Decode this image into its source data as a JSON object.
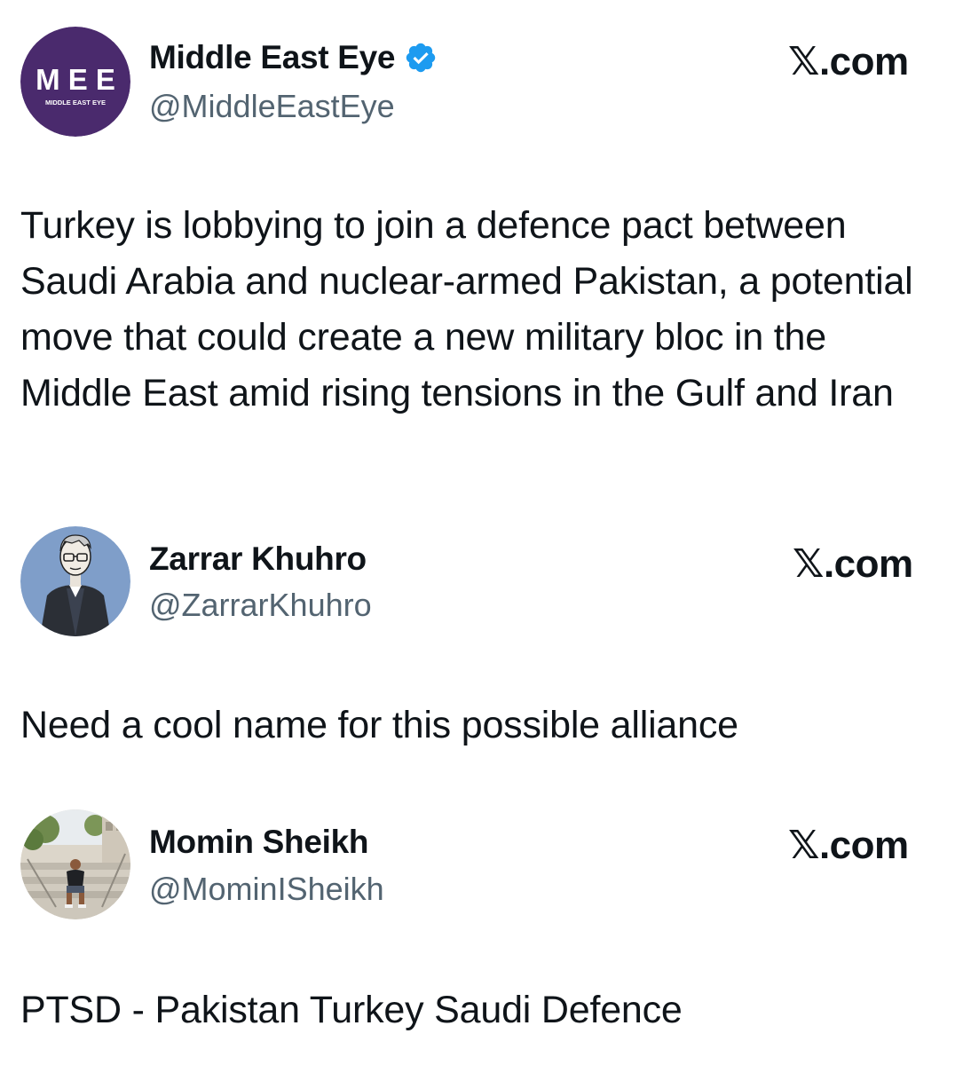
{
  "posts": [
    {
      "display_name": "Middle East Eye",
      "handle": "@MiddleEastEye",
      "verified": true,
      "source": "𝕏.com",
      "avatar": {
        "icon": "mee-logo",
        "logo_text": "M E E",
        "logo_subtext": "MIDDLE EAST EYE",
        "bg_color": "#4a2a6d"
      },
      "text": "Turkey is lobbying to join a defence pact between Saudi Arabia and nuclear-armed Pakistan, a potential move that could create a new military bloc in the Middle East amid rising tensions in the Gulf and Iran"
    },
    {
      "display_name": "Zarrar Khuhro",
      "handle": "@ZarrarKhuhro",
      "verified": false,
      "source": "𝕏.com",
      "avatar": {
        "icon": "cartoon-portrait",
        "bg_color": "#7f9ec9"
      },
      "text": "Need a cool name for this possible alliance"
    },
    {
      "display_name": "Momin Sheikh",
      "handle": "@MominISheikh",
      "verified": false,
      "source": "𝕏.com",
      "avatar": {
        "icon": "photo-person-on-steps",
        "bg_color": "#c9c4ba"
      },
      "text": "PTSD - Pakistan Turkey Saudi Defence"
    }
  ],
  "colors": {
    "text_primary": "#0f1419",
    "text_secondary": "#536471",
    "verified_blue": "#1d9bf0"
  }
}
